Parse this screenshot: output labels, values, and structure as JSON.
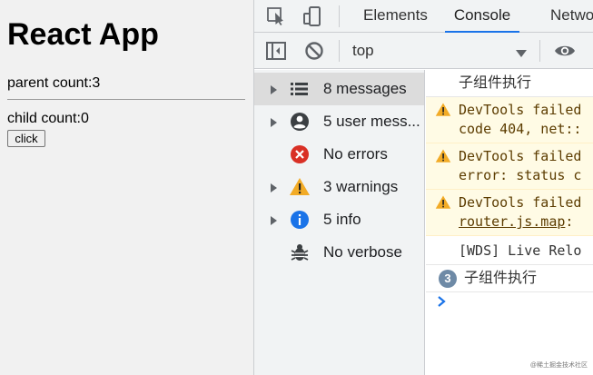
{
  "app": {
    "title": "React App",
    "parent_count": "parent count:3",
    "child_count": "child count:0",
    "click_label": "click"
  },
  "devtools": {
    "tabs": [
      {
        "label": "Elements",
        "active": false
      },
      {
        "label": "Console",
        "active": true
      },
      {
        "label": "Netwo",
        "active": false
      }
    ],
    "context": "top",
    "sidebar": [
      {
        "label": "8 messages",
        "icon": "list-icon",
        "selected": true
      },
      {
        "label": "5 user mess...",
        "icon": "user-icon",
        "selected": false
      },
      {
        "label": "No errors",
        "icon": "error-icon",
        "selected": false
      },
      {
        "label": "3 warnings",
        "icon": "warning-icon",
        "selected": false
      },
      {
        "label": "5 info",
        "icon": "info-icon",
        "selected": false
      },
      {
        "label": "No verbose",
        "icon": "bug-icon",
        "selected": false
      }
    ],
    "log": {
      "row0": "子组件执行",
      "warn1_line1": "DevTools failed",
      "warn1_line2": "code 404, net::",
      "warn2_line1": "DevTools failed",
      "warn2_line2": "error: status c",
      "warn3_line1": "DevTools failed",
      "warn3_link": "router.js.map",
      "warn3_suffix": ":",
      "wds": "[WDS] Live Relo",
      "repeat_count": "3",
      "repeat_text": "子组件执行"
    },
    "colors": {
      "accent": "#1a73e8",
      "warning_bg": "#fffbe5",
      "warning_icon": "#f2ab26",
      "error_icon": "#d93025",
      "info_icon": "#1a73e8"
    }
  },
  "watermark": "@稀土掘金技术社区"
}
